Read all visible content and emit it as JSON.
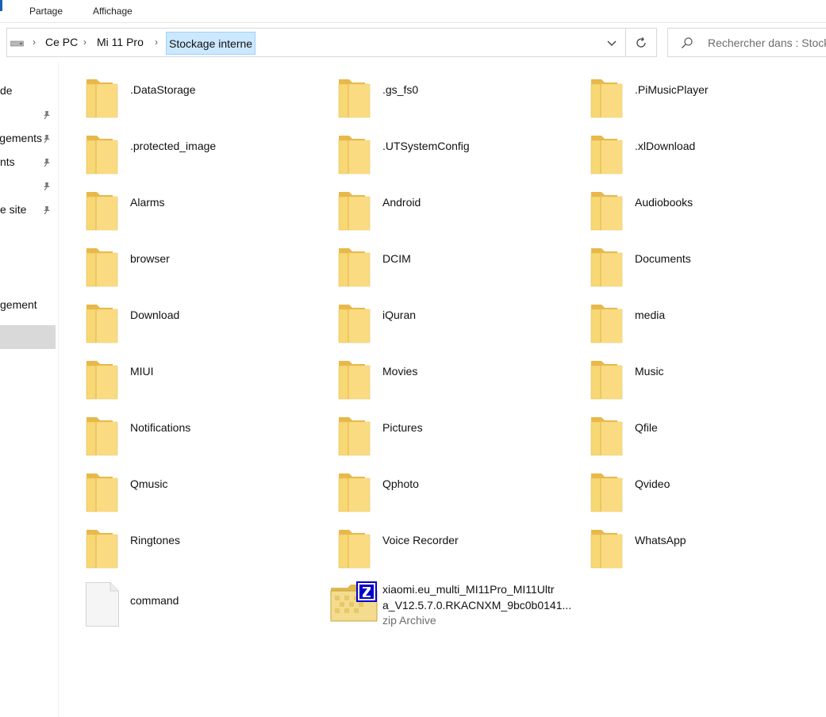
{
  "ribbon": {
    "tabs": [
      "Partage",
      "Affichage"
    ]
  },
  "address": {
    "crumbs": [
      "Ce PC",
      "Mi 11 Pro",
      "Stockage interne"
    ],
    "search_placeholder": "Rechercher dans : Stockage interne"
  },
  "nav": {
    "items": [
      {
        "label": "de",
        "pinned": false
      },
      {
        "label": "",
        "pinned": true
      },
      {
        "label": "gements",
        "pinned": true
      },
      {
        "label": "nts",
        "pinned": true
      },
      {
        "label": "",
        "pinned": true
      },
      {
        "label": "e site",
        "pinned": true
      },
      {
        "label": "gement",
        "pinned": false
      }
    ]
  },
  "files": {
    "folders": [
      ".DataStorage",
      ".gs_fs0",
      ".PiMusicPlayer",
      ".protected_image",
      ".UTSystemConfig",
      ".xlDownload",
      "Alarms",
      "Android",
      "Audiobooks",
      "browser",
      "DCIM",
      "Documents",
      "Download",
      "iQuran",
      "media",
      "MIUI",
      "Movies",
      "Music",
      "Notifications",
      "Pictures",
      "Qfile",
      "Qmusic",
      "Qphoto",
      "Qvideo",
      "Ringtones",
      "Voice Recorder",
      "WhatsApp"
    ],
    "file": {
      "name": "command",
      "icon": "blank-file-icon"
    },
    "zip": {
      "name_line1": "xiaomi.eu_multi_MI11Pro_MI11Ultr",
      "name_line2": "a_V12.5.7.0.RKACNXM_9bc0b0141...",
      "type": "zip Archive",
      "icon": "zip-archive-icon"
    }
  },
  "colors": {
    "folder_front": "#f8d775",
    "folder_back": "#e8b84a",
    "selection": "#cce8ff",
    "zip_badge": "#0000cc"
  }
}
